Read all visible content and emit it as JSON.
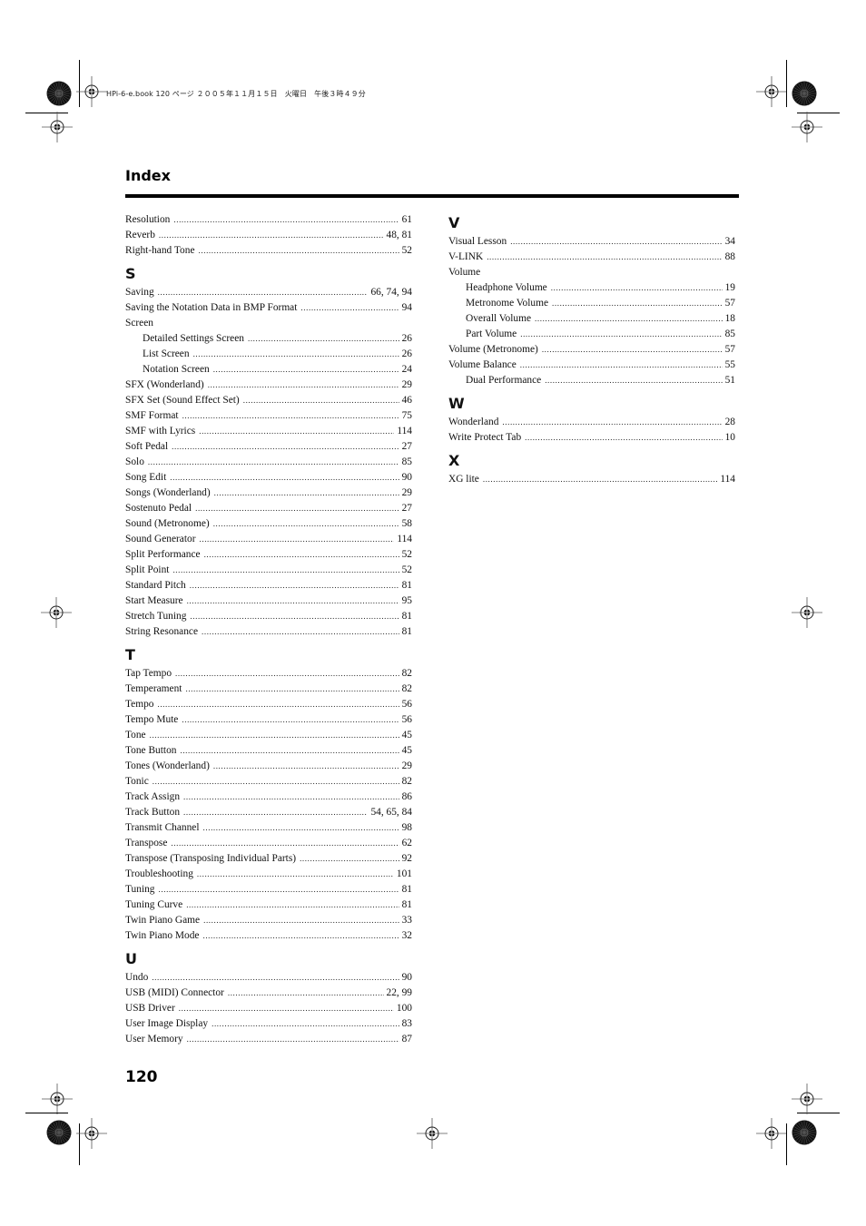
{
  "slug_line": "HPi-6-e.book  120 ページ  ２００５年１１月１５日　火曜日　午後３時４９分",
  "header": {
    "title": "Index"
  },
  "left_column": [
    {
      "type": "entry",
      "label": "Resolution",
      "pages": "61"
    },
    {
      "type": "entry",
      "label": "Reverb",
      "pages": "48, 81"
    },
    {
      "type": "entry",
      "label": "Right-hand Tone",
      "pages": "52"
    },
    {
      "type": "letter",
      "label": "S"
    },
    {
      "type": "entry",
      "label": "Saving",
      "pages": "66, 74, 94"
    },
    {
      "type": "entry",
      "label": "Saving the Notation Data in BMP Format",
      "pages": "94"
    },
    {
      "type": "heading",
      "label": "Screen"
    },
    {
      "type": "sub",
      "label": "Detailed Settings Screen",
      "pages": "26"
    },
    {
      "type": "sub",
      "label": "List Screen",
      "pages": "26"
    },
    {
      "type": "sub",
      "label": "Notation Screen",
      "pages": "24"
    },
    {
      "type": "entry",
      "label": "SFX (Wonderland)",
      "pages": "29"
    },
    {
      "type": "entry",
      "label": "SFX Set (Sound Effect Set)",
      "pages": "46"
    },
    {
      "type": "entry",
      "label": "SMF Format",
      "pages": "75"
    },
    {
      "type": "entry",
      "label": "SMF with Lyrics",
      "pages": "114"
    },
    {
      "type": "entry",
      "label": "Soft Pedal",
      "pages": "27"
    },
    {
      "type": "entry",
      "label": "Solo",
      "pages": "85"
    },
    {
      "type": "entry",
      "label": "Song Edit",
      "pages": "90"
    },
    {
      "type": "entry",
      "label": "Songs (Wonderland)",
      "pages": "29"
    },
    {
      "type": "entry",
      "label": "Sostenuto Pedal",
      "pages": "27"
    },
    {
      "type": "entry",
      "label": "Sound (Metronome)",
      "pages": "58"
    },
    {
      "type": "entry",
      "label": "Sound Generator",
      "pages": "114"
    },
    {
      "type": "entry",
      "label": "Split Performance",
      "pages": "52"
    },
    {
      "type": "entry",
      "label": "Split Point",
      "pages": "52"
    },
    {
      "type": "entry",
      "label": "Standard Pitch",
      "pages": "81"
    },
    {
      "type": "entry",
      "label": "Start Measure",
      "pages": "95"
    },
    {
      "type": "entry",
      "label": "Stretch Tuning",
      "pages": "81"
    },
    {
      "type": "entry",
      "label": "String Resonance",
      "pages": "81"
    },
    {
      "type": "letter",
      "label": "T"
    },
    {
      "type": "entry",
      "label": "Tap Tempo",
      "pages": "82"
    },
    {
      "type": "entry",
      "label": "Temperament",
      "pages": "82"
    },
    {
      "type": "entry",
      "label": "Tempo",
      "pages": "56"
    },
    {
      "type": "entry",
      "label": "Tempo Mute",
      "pages": "56"
    },
    {
      "type": "entry",
      "label": "Tone",
      "pages": "45"
    },
    {
      "type": "entry",
      "label": "Tone Button",
      "pages": "45"
    },
    {
      "type": "entry",
      "label": "Tones (Wonderland)",
      "pages": "29"
    },
    {
      "type": "entry",
      "label": "Tonic",
      "pages": "82"
    },
    {
      "type": "entry",
      "label": "Track Assign",
      "pages": "86"
    },
    {
      "type": "entry",
      "label": "Track Button",
      "pages": "54, 65, 84"
    },
    {
      "type": "entry",
      "label": "Transmit Channel",
      "pages": "98"
    },
    {
      "type": "entry",
      "label": "Transpose",
      "pages": "62"
    },
    {
      "type": "entry",
      "label": "Transpose (Transposing Individual Parts)",
      "pages": "92"
    },
    {
      "type": "entry",
      "label": "Troubleshooting",
      "pages": "101"
    },
    {
      "type": "entry",
      "label": "Tuning",
      "pages": "81"
    },
    {
      "type": "entry",
      "label": "Tuning Curve",
      "pages": "81"
    },
    {
      "type": "entry",
      "label": "Twin Piano Game",
      "pages": "33"
    },
    {
      "type": "entry",
      "label": "Twin Piano Mode",
      "pages": "32"
    },
    {
      "type": "letter",
      "label": "U"
    },
    {
      "type": "entry",
      "label": "Undo",
      "pages": "90"
    },
    {
      "type": "entry",
      "label": "USB (MIDI) Connector",
      "pages": "22, 99"
    },
    {
      "type": "entry",
      "label": "USB Driver",
      "pages": "100"
    },
    {
      "type": "entry",
      "label": "User Image Display",
      "pages": "83"
    },
    {
      "type": "entry",
      "label": "User Memory",
      "pages": "87"
    }
  ],
  "right_column": [
    {
      "type": "letter",
      "label": "V"
    },
    {
      "type": "entry",
      "label": "Visual Lesson",
      "pages": "34"
    },
    {
      "type": "entry",
      "label": "V-LINK",
      "pages": "88"
    },
    {
      "type": "heading",
      "label": "Volume"
    },
    {
      "type": "sub",
      "label": "Headphone Volume",
      "pages": "19"
    },
    {
      "type": "sub",
      "label": "Metronome Volume",
      "pages": "57"
    },
    {
      "type": "sub",
      "label": "Overall Volume",
      "pages": "18"
    },
    {
      "type": "sub",
      "label": "Part Volume",
      "pages": "85"
    },
    {
      "type": "entry",
      "label": "Volume (Metronome)",
      "pages": "57"
    },
    {
      "type": "entry",
      "label": "Volume Balance",
      "pages": "55"
    },
    {
      "type": "sub",
      "label": "Dual Performance",
      "pages": "51"
    },
    {
      "type": "letter",
      "label": "W"
    },
    {
      "type": "entry",
      "label": "Wonderland",
      "pages": "28"
    },
    {
      "type": "entry",
      "label": "Write Protect Tab",
      "pages": "10"
    },
    {
      "type": "letter",
      "label": "X"
    },
    {
      "type": "entry",
      "label": "XG lite",
      "pages": "114"
    }
  ],
  "footer": {
    "page_number": "120"
  },
  "colors": {
    "text": "#111111",
    "rule": "#000000",
    "registration": "#333333"
  }
}
